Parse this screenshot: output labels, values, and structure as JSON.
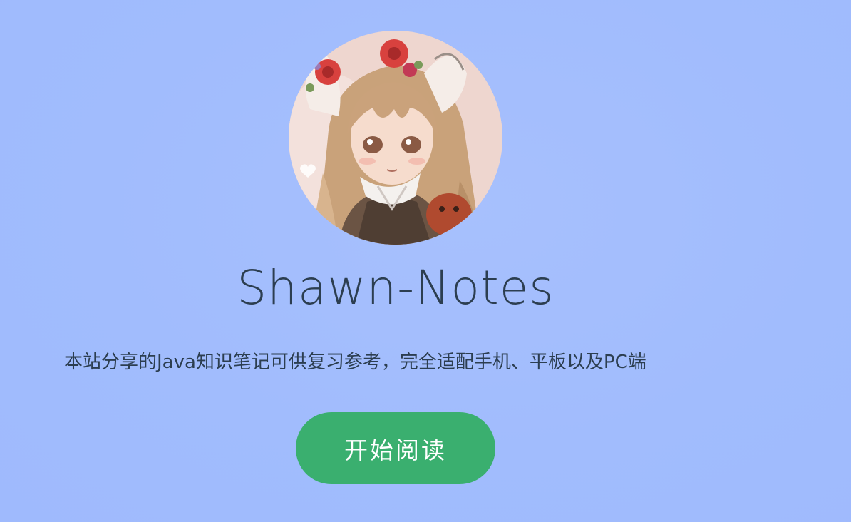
{
  "hero": {
    "avatar_icon": "anime-girl-avatar-icon",
    "title": "Shawn-Notes",
    "tagline": "本站分享的Java知识笔记可供复习参考，完全适配手机、平板以及PC端",
    "cta_label": "开始阅读"
  },
  "colors": {
    "background": "#a1bcfd",
    "text": "#2c3e50",
    "button": "#3aaf6f",
    "button_text": "#ffffff"
  }
}
